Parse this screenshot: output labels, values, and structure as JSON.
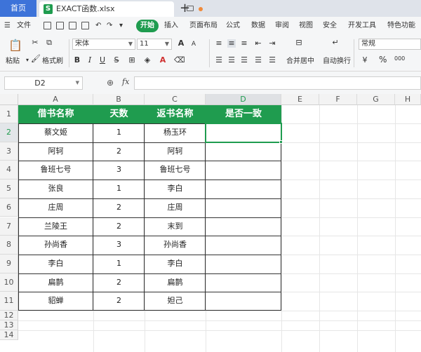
{
  "tabs": {
    "home": "首页",
    "file": "EXACT函数.xlsx",
    "file_icon": "S",
    "new_tab": "+"
  },
  "menu": {
    "items": [
      "文件",
      "开始",
      "插入",
      "页面布局",
      "公式",
      "数据",
      "审阅",
      "视图",
      "安全",
      "开发工具",
      "特色功能"
    ],
    "active": "开始"
  },
  "ribbon": {
    "paste": "粘贴",
    "format_painter": "格式刷",
    "font_name": "宋体",
    "font_size": "11",
    "merge_center": "合并居中",
    "auto_wrap": "自动换行",
    "number_format": "常规",
    "percent": "%",
    "thousands": "000"
  },
  "formula_bar": {
    "cell_ref": "D2",
    "fx": "fx",
    "value": ""
  },
  "sheet": {
    "columns": [
      "A",
      "B",
      "C",
      "D",
      "E",
      "F",
      "G",
      "H"
    ],
    "active_column": "D",
    "rows": [
      "1",
      "2",
      "3",
      "4",
      "5",
      "6",
      "7",
      "8",
      "9",
      "10",
      "11",
      "12",
      "13",
      "14"
    ],
    "active_row": "2",
    "headers": [
      "借书名称",
      "天数",
      "返书名称",
      "是否一致"
    ],
    "data": [
      [
        "蔡文姬",
        "1",
        "杨玉环",
        ""
      ],
      [
        "阿轲",
        "2",
        "阿轲",
        ""
      ],
      [
        "鲁班七号",
        "3",
        "鲁班七号",
        ""
      ],
      [
        "张良",
        "1",
        "李白",
        ""
      ],
      [
        "庄周",
        "2",
        "庄周",
        ""
      ],
      [
        "兰陵王",
        "2",
        "末到",
        ""
      ],
      [
        "孙尚香",
        "3",
        "孙尚香",
        ""
      ],
      [
        "李白",
        "1",
        "李白",
        ""
      ],
      [
        "扁鹊",
        "2",
        "扁鹊",
        ""
      ],
      [
        "貂蝉",
        "2",
        "妲己",
        ""
      ]
    ]
  },
  "colors": {
    "accent": "#1f9c4f",
    "home_tab": "#3d73d9"
  }
}
